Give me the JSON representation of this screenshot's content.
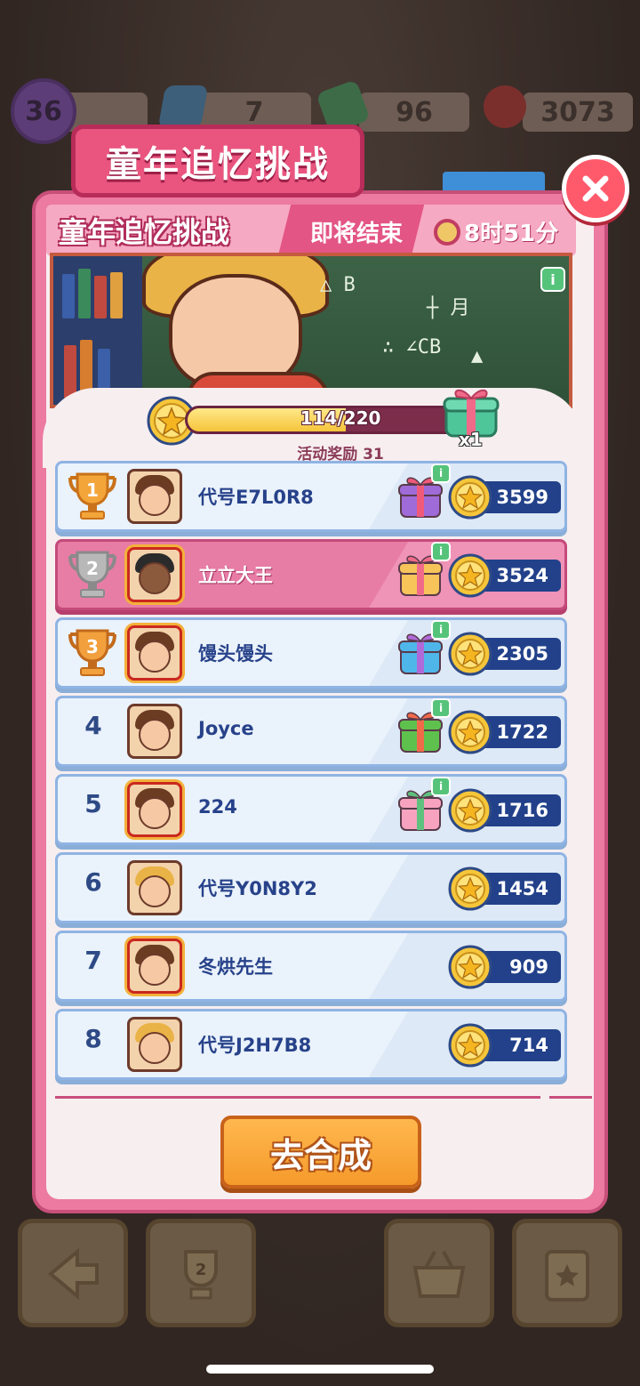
{
  "top_bar": {
    "level": "36",
    "energy": "7",
    "cash": "96",
    "gems": "3073"
  },
  "title_tab": "童年追忆挑战",
  "panel": {
    "header_title": "童年追忆挑战",
    "ending_label": "即将结束",
    "timer": "8时51分",
    "info_label": "i"
  },
  "progress": {
    "current": 114,
    "max": 220,
    "text": "114/220",
    "reward_multiplier": "x1",
    "activity_reward": "活动奖励 31"
  },
  "leaderboard": [
    {
      "rank": "1",
      "name": "代号E7L0R8",
      "score": "3599",
      "trophy": "gold",
      "gift": "purple",
      "me": false
    },
    {
      "rank": "2",
      "name": "立立大王",
      "score": "3524",
      "trophy": "silver",
      "gift": "pink-gold",
      "me": true
    },
    {
      "rank": "3",
      "name": "馒头馒头",
      "score": "2305",
      "trophy": "bronze",
      "gift": "blue",
      "me": false
    },
    {
      "rank": "4",
      "name": "Joyce",
      "score": "1722",
      "trophy": "",
      "gift": "green",
      "me": false
    },
    {
      "rank": "5",
      "name": "224",
      "score": "1716",
      "trophy": "",
      "gift": "pink",
      "me": false
    },
    {
      "rank": "6",
      "name": "代号Y0N8Y2",
      "score": "1454",
      "trophy": "",
      "gift": "",
      "me": false
    },
    {
      "rank": "7",
      "name": "冬烘先生",
      "score": "909",
      "trophy": "",
      "gift": "",
      "me": false
    },
    {
      "rank": "8",
      "name": "代号J2H7B8",
      "score": "714",
      "trophy": "",
      "gift": "",
      "me": false
    }
  ],
  "go_button": "去合成",
  "bottom_bar": {
    "trophy_badge": "2"
  },
  "colors": {
    "accent_pink": "#e9557f",
    "score_pill": "#22418a",
    "go_button": "#f59a2b"
  }
}
